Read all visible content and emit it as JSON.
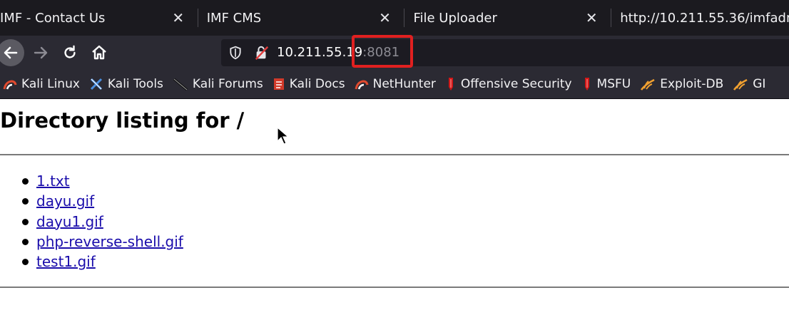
{
  "tabs": [
    {
      "title": "IMF - Contact Us",
      "close": "✕"
    },
    {
      "title": "IMF CMS",
      "close": "✕"
    },
    {
      "title": "File Uploader",
      "close": "✕"
    },
    {
      "title": "http://10.211.55.36/imfadmi",
      "close": ""
    }
  ],
  "nav": {
    "url_host": "10.211.55.19",
    "url_port": ":8081"
  },
  "bookmarks": [
    {
      "label": "Kali Linux",
      "icon": "kali-dragon-icon"
    },
    {
      "label": "Kali Tools",
      "icon": "kali-tools-icon"
    },
    {
      "label": "Kali Forums",
      "icon": "kali-forums-icon"
    },
    {
      "label": "Kali Docs",
      "icon": "kali-docs-icon"
    },
    {
      "label": "NetHunter",
      "icon": "nethunter-icon"
    },
    {
      "label": "Offensive Security",
      "icon": "offsec-icon"
    },
    {
      "label": "MSFU",
      "icon": "msfu-icon"
    },
    {
      "label": "Exploit-DB",
      "icon": "exploit-db-icon"
    },
    {
      "label": "GI",
      "icon": "ghdb-icon"
    }
  ],
  "page": {
    "heading": "Directory listing for /",
    "files": [
      "1.txt",
      "dayu.gif",
      "dayu1.gif",
      "php-reverse-shell.gif",
      "test1.gif"
    ]
  },
  "colors": {
    "tab_bg": "#1b1a1f",
    "toolbar_bg": "#2b2a33",
    "link": "#1a0dab",
    "highlight": "#e02020"
  }
}
